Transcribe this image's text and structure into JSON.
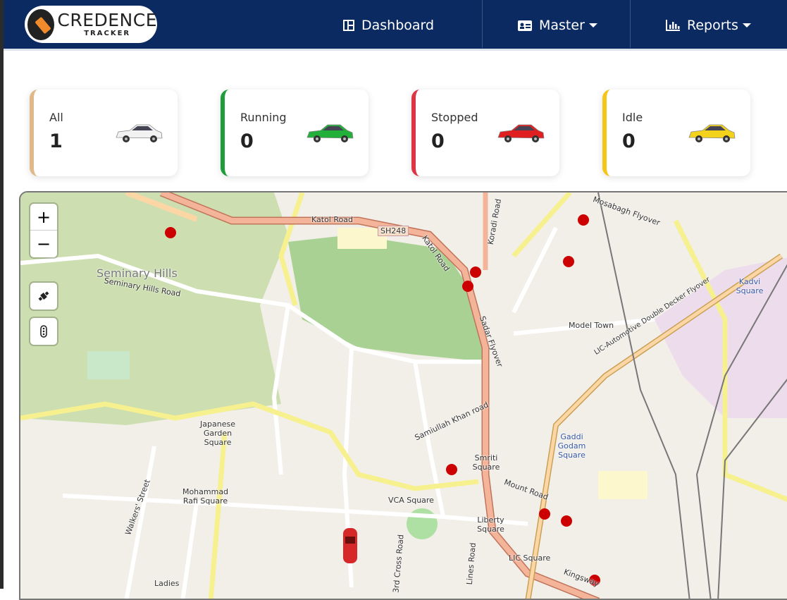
{
  "logo": {
    "main": "CREDENCE",
    "sub": "TRACKER"
  },
  "nav": {
    "dashboard": "Dashboard",
    "master": "Master",
    "reports": "Reports"
  },
  "cards": [
    {
      "label": "All",
      "count": "1",
      "color": "#e0b98a",
      "car_color": "#f2f2f2"
    },
    {
      "label": "Running",
      "count": "0",
      "color": "#1f9d3a",
      "car_color": "#22b03a"
    },
    {
      "label": "Stopped",
      "count": "0",
      "color": "#dc3545",
      "car_color": "#e02020"
    },
    {
      "label": "Idle",
      "count": "0",
      "color": "#f5c518",
      "car_color": "#f2d21a"
    }
  ],
  "map": {
    "zoom_in": "+",
    "zoom_out": "−",
    "labels": {
      "seminary_hills": "Seminary Hills",
      "seminary_road": "Seminary Hills Road",
      "katol_road": "Katol Road",
      "sh248": "SH248",
      "katol_road2": "Katol Road",
      "koradi": "Koradi Road",
      "sadar": "Sadar Flyover",
      "model_town": "Model Town",
      "kadvi": "Kadvi Square",
      "japanese": "Japanese Garden Square",
      "mohammad": "Mohammad Rafi Square",
      "vca": "VCA Square",
      "smriti": "Smriti Square",
      "mount": "Mount Road",
      "liberty": "Liberty Square",
      "lic": "LIC Square",
      "gaddi": "Gaddi Godam Square",
      "samiullah": "Samiullah Khan road",
      "walkers": "Walkers' Street",
      "lic_flyover": "LIC-Automotive Double Decker Flyover",
      "mosabagh": "Mosabagh Flyover",
      "ladies": "Ladies",
      "kingsway": "Kingsway",
      "cross": "3rd Cross Road",
      "lines": "Lines Road"
    }
  }
}
